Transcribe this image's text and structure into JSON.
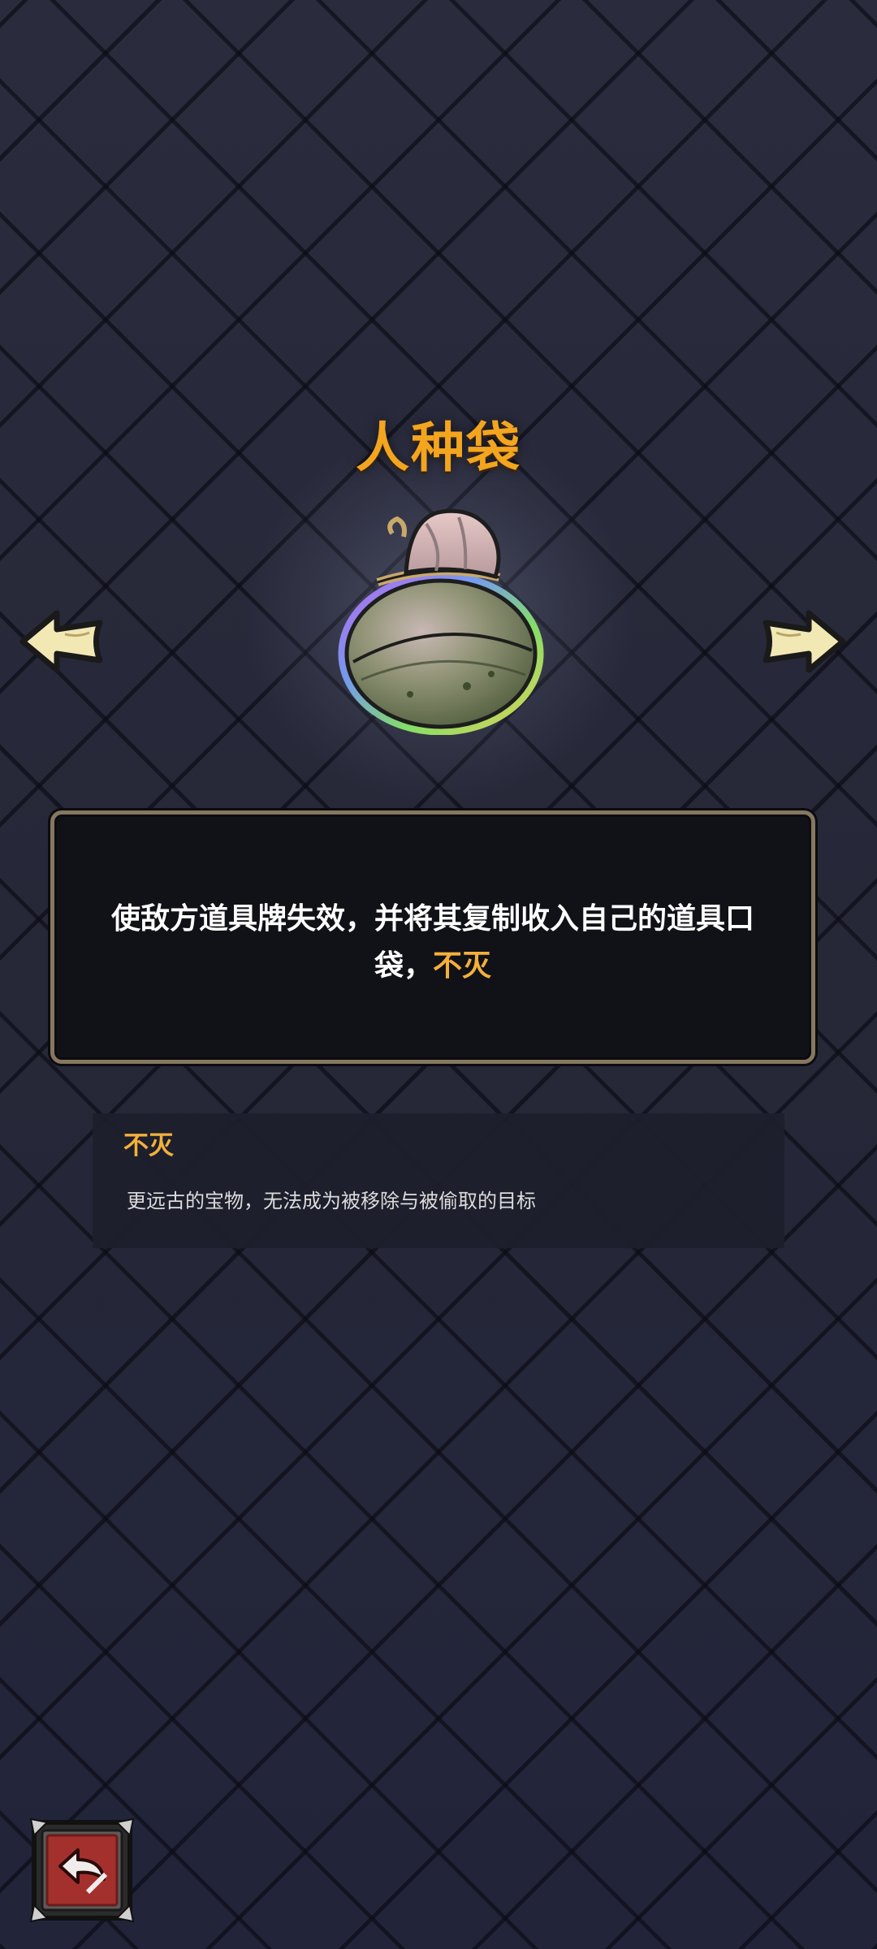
{
  "item": {
    "name": "人种袋",
    "image": "cloth-sack-icon"
  },
  "description": {
    "text": "使敌方道具牌失效，并将其复制收入自己的道具口袋，",
    "keyword": "不灭"
  },
  "keyword_info": {
    "title": "不灭",
    "description": "更远古的宝物，无法成为被移除与被偷取的目标"
  },
  "navigation": {
    "prev_icon": "arrow-left-icon",
    "next_icon": "arrow-right-icon",
    "back_icon": "return-arrow-icon"
  },
  "colors": {
    "title": "#f3a51f",
    "keyword": "#f3b03b",
    "panel_border": "#85785e",
    "background": "#262838"
  }
}
